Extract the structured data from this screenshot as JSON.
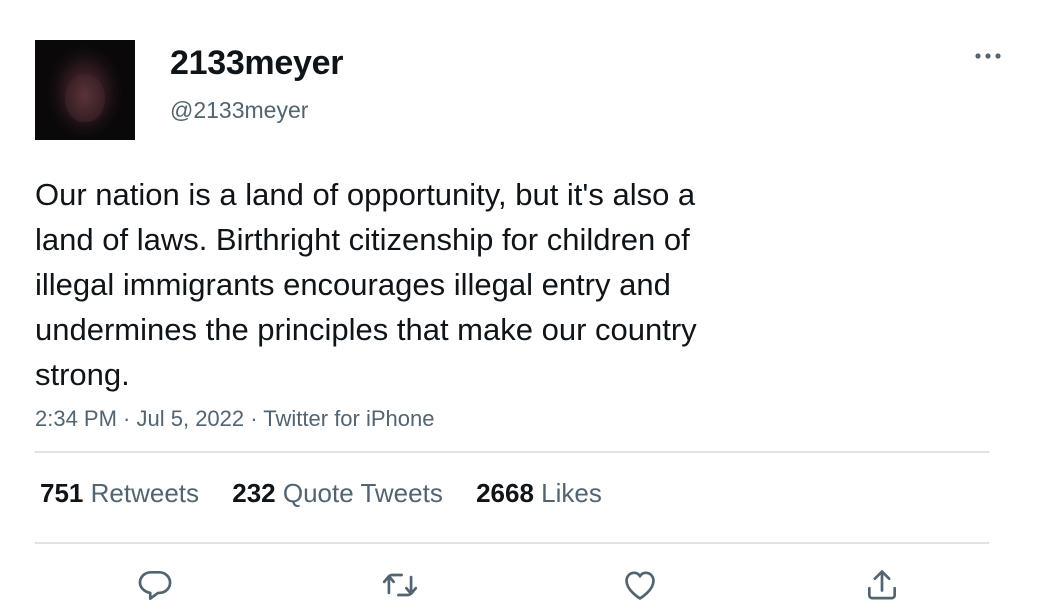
{
  "author": {
    "display_name": "2133meyer",
    "handle": "@2133meyer"
  },
  "tweet": {
    "text": "Our nation is a land of opportunity, but it's also a\nland of laws. Birthright citizenship for children of\nillegal immigrants encourages illegal entry and\nundermines the principles that make our country\nstrong.",
    "time": "2:34 PM",
    "date": "Jul 5, 2022",
    "source": "Twitter for iPhone",
    "separator": " · "
  },
  "stats": {
    "retweets_count": "751",
    "retweets_label": "Retweets",
    "quotes_count": "232",
    "quotes_label": "Quote Tweets",
    "likes_count": "2668",
    "likes_label": "Likes"
  },
  "actions": {
    "reply_icon": "reply-icon",
    "retweet_icon": "retweet-icon",
    "like_icon": "heart-icon",
    "share_icon": "share-icon"
  },
  "colors": {
    "text_primary": "#0f1419",
    "text_secondary": "#536471",
    "divider": "#dfe3e7"
  }
}
